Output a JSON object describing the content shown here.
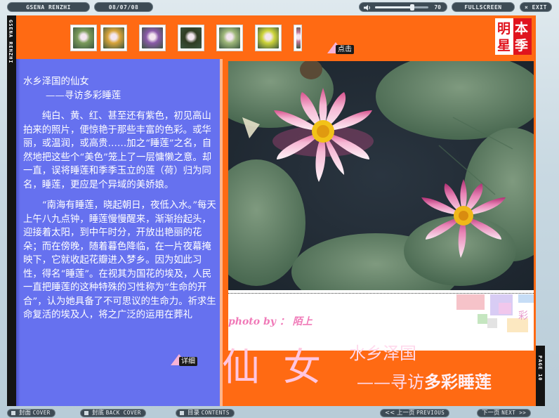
{
  "header": {
    "brand": "GSENA RENZHI",
    "date": "08/07/08",
    "volume": {
      "value": "70",
      "level_percent": 70
    },
    "fullscreen_label": "FULLSCREEN",
    "exit_label": "× EXIT"
  },
  "spine": {
    "left_text": "GSENA RENZHI",
    "right_text": "PAGE 10"
  },
  "thumbnails": [
    {
      "name": "thumb-1",
      "color": "#7a9a5a"
    },
    {
      "name": "thumb-2",
      "color": "#d8a43a"
    },
    {
      "name": "thumb-3",
      "color": "#8a5aa8"
    },
    {
      "name": "thumb-4",
      "color": "#2f3b22"
    },
    {
      "name": "thumb-5",
      "color": "#9fb87a"
    },
    {
      "name": "thumb-6",
      "color": "#cdd43a"
    },
    {
      "name": "thumb-7",
      "color": "#c27a9a"
    }
  ],
  "click_hint": "点击",
  "detail_hint": "详细",
  "seal": {
    "chars": [
      "本",
      "季",
      "明",
      "星"
    ],
    "color": "#e0141e"
  },
  "article": {
    "title_line1": "水乡泽国的仙女",
    "title_line2": "——寻访多彩睡莲",
    "paragraphs": [
      "纯白、黄、红、甚至还有紫色，初见高山拍来的照片，便惊艳于那些丰富的色彩。或华丽，或温润，或高贵……加之“睡莲”之名，自然地把这些个“美色”笼上了一层慵懒之意。却一直，误将睡莲和季季玉立的莲（荷）归为同名，睡莲，更应是个异域的美娇娘。",
      "“南海有睡莲，晓起朝日，夜低入水。”每天上午八九点钟，睡莲慢慢醒来，渐渐抬起头，迎接着太阳，到中午时分，开放出艳丽的花朵；而在傍晚，随着暮色降临，在一片夜幕掩映下，它就收起花瓣进入梦乡。因为如此习性，得名“睡莲”。在视其为国花的埃及，人民一直把睡莲的这种特殊的习性称为“生命的开合”，认为她具备了不可思议的生命力。祈求生命复活的埃及人，将之广泛的运用在葬礼"
    ]
  },
  "photo": {
    "credit": "photo by ： 陌上",
    "corner_text": "彩"
  },
  "feature": {
    "big_title": "仙 女",
    "subtitle1_a": "水乡泽国",
    "subtitle2_a": "——寻访",
    "subtitle2_b": "多彩睡莲"
  },
  "footer": {
    "front_cover_cn": "封面",
    "front_cover_en": "COVER",
    "back_cover_cn": "封底",
    "back_cover_en": "BACK COVER",
    "contents_cn": "目录",
    "contents_en": "CONTENTS",
    "prev_cn": "<< 上一页",
    "prev_en": "PREVIOUS",
    "next_cn": "下一页",
    "next_en": "NEXT >>"
  },
  "colors": {
    "orange": "#ff6a13",
    "left_page": "#6671ef",
    "pink": "#ffc6df"
  }
}
